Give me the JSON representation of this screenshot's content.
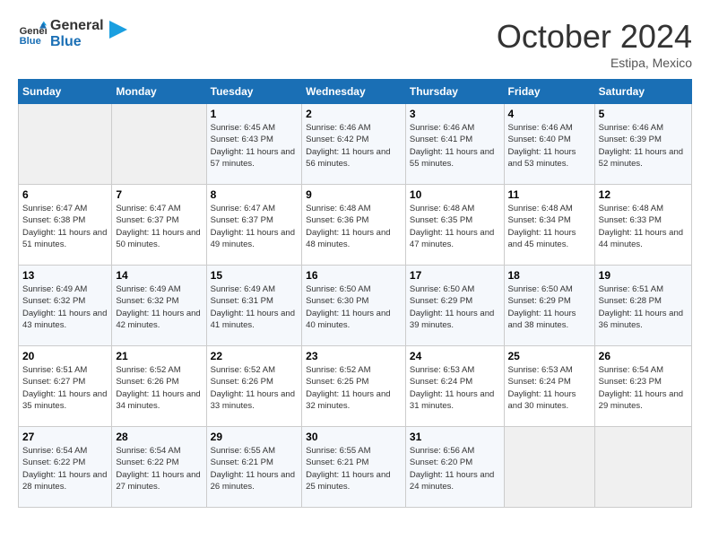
{
  "logo": {
    "line1": "General",
    "line2": "Blue"
  },
  "title": "October 2024",
  "location": "Estipa, Mexico",
  "days_header": [
    "Sunday",
    "Monday",
    "Tuesday",
    "Wednesday",
    "Thursday",
    "Friday",
    "Saturday"
  ],
  "weeks": [
    [
      {
        "day": "",
        "sunrise": "",
        "sunset": "",
        "daylight": ""
      },
      {
        "day": "",
        "sunrise": "",
        "sunset": "",
        "daylight": ""
      },
      {
        "day": "1",
        "sunrise": "Sunrise: 6:45 AM",
        "sunset": "Sunset: 6:43 PM",
        "daylight": "Daylight: 11 hours and 57 minutes."
      },
      {
        "day": "2",
        "sunrise": "Sunrise: 6:46 AM",
        "sunset": "Sunset: 6:42 PM",
        "daylight": "Daylight: 11 hours and 56 minutes."
      },
      {
        "day": "3",
        "sunrise": "Sunrise: 6:46 AM",
        "sunset": "Sunset: 6:41 PM",
        "daylight": "Daylight: 11 hours and 55 minutes."
      },
      {
        "day": "4",
        "sunrise": "Sunrise: 6:46 AM",
        "sunset": "Sunset: 6:40 PM",
        "daylight": "Daylight: 11 hours and 53 minutes."
      },
      {
        "day": "5",
        "sunrise": "Sunrise: 6:46 AM",
        "sunset": "Sunset: 6:39 PM",
        "daylight": "Daylight: 11 hours and 52 minutes."
      }
    ],
    [
      {
        "day": "6",
        "sunrise": "Sunrise: 6:47 AM",
        "sunset": "Sunset: 6:38 PM",
        "daylight": "Daylight: 11 hours and 51 minutes."
      },
      {
        "day": "7",
        "sunrise": "Sunrise: 6:47 AM",
        "sunset": "Sunset: 6:37 PM",
        "daylight": "Daylight: 11 hours and 50 minutes."
      },
      {
        "day": "8",
        "sunrise": "Sunrise: 6:47 AM",
        "sunset": "Sunset: 6:37 PM",
        "daylight": "Daylight: 11 hours and 49 minutes."
      },
      {
        "day": "9",
        "sunrise": "Sunrise: 6:48 AM",
        "sunset": "Sunset: 6:36 PM",
        "daylight": "Daylight: 11 hours and 48 minutes."
      },
      {
        "day": "10",
        "sunrise": "Sunrise: 6:48 AM",
        "sunset": "Sunset: 6:35 PM",
        "daylight": "Daylight: 11 hours and 47 minutes."
      },
      {
        "day": "11",
        "sunrise": "Sunrise: 6:48 AM",
        "sunset": "Sunset: 6:34 PM",
        "daylight": "Daylight: 11 hours and 45 minutes."
      },
      {
        "day": "12",
        "sunrise": "Sunrise: 6:48 AM",
        "sunset": "Sunset: 6:33 PM",
        "daylight": "Daylight: 11 hours and 44 minutes."
      }
    ],
    [
      {
        "day": "13",
        "sunrise": "Sunrise: 6:49 AM",
        "sunset": "Sunset: 6:32 PM",
        "daylight": "Daylight: 11 hours and 43 minutes."
      },
      {
        "day": "14",
        "sunrise": "Sunrise: 6:49 AM",
        "sunset": "Sunset: 6:32 PM",
        "daylight": "Daylight: 11 hours and 42 minutes."
      },
      {
        "day": "15",
        "sunrise": "Sunrise: 6:49 AM",
        "sunset": "Sunset: 6:31 PM",
        "daylight": "Daylight: 11 hours and 41 minutes."
      },
      {
        "day": "16",
        "sunrise": "Sunrise: 6:50 AM",
        "sunset": "Sunset: 6:30 PM",
        "daylight": "Daylight: 11 hours and 40 minutes."
      },
      {
        "day": "17",
        "sunrise": "Sunrise: 6:50 AM",
        "sunset": "Sunset: 6:29 PM",
        "daylight": "Daylight: 11 hours and 39 minutes."
      },
      {
        "day": "18",
        "sunrise": "Sunrise: 6:50 AM",
        "sunset": "Sunset: 6:29 PM",
        "daylight": "Daylight: 11 hours and 38 minutes."
      },
      {
        "day": "19",
        "sunrise": "Sunrise: 6:51 AM",
        "sunset": "Sunset: 6:28 PM",
        "daylight": "Daylight: 11 hours and 36 minutes."
      }
    ],
    [
      {
        "day": "20",
        "sunrise": "Sunrise: 6:51 AM",
        "sunset": "Sunset: 6:27 PM",
        "daylight": "Daylight: 11 hours and 35 minutes."
      },
      {
        "day": "21",
        "sunrise": "Sunrise: 6:52 AM",
        "sunset": "Sunset: 6:26 PM",
        "daylight": "Daylight: 11 hours and 34 minutes."
      },
      {
        "day": "22",
        "sunrise": "Sunrise: 6:52 AM",
        "sunset": "Sunset: 6:26 PM",
        "daylight": "Daylight: 11 hours and 33 minutes."
      },
      {
        "day": "23",
        "sunrise": "Sunrise: 6:52 AM",
        "sunset": "Sunset: 6:25 PM",
        "daylight": "Daylight: 11 hours and 32 minutes."
      },
      {
        "day": "24",
        "sunrise": "Sunrise: 6:53 AM",
        "sunset": "Sunset: 6:24 PM",
        "daylight": "Daylight: 11 hours and 31 minutes."
      },
      {
        "day": "25",
        "sunrise": "Sunrise: 6:53 AM",
        "sunset": "Sunset: 6:24 PM",
        "daylight": "Daylight: 11 hours and 30 minutes."
      },
      {
        "day": "26",
        "sunrise": "Sunrise: 6:54 AM",
        "sunset": "Sunset: 6:23 PM",
        "daylight": "Daylight: 11 hours and 29 minutes."
      }
    ],
    [
      {
        "day": "27",
        "sunrise": "Sunrise: 6:54 AM",
        "sunset": "Sunset: 6:22 PM",
        "daylight": "Daylight: 11 hours and 28 minutes."
      },
      {
        "day": "28",
        "sunrise": "Sunrise: 6:54 AM",
        "sunset": "Sunset: 6:22 PM",
        "daylight": "Daylight: 11 hours and 27 minutes."
      },
      {
        "day": "29",
        "sunrise": "Sunrise: 6:55 AM",
        "sunset": "Sunset: 6:21 PM",
        "daylight": "Daylight: 11 hours and 26 minutes."
      },
      {
        "day": "30",
        "sunrise": "Sunrise: 6:55 AM",
        "sunset": "Sunset: 6:21 PM",
        "daylight": "Daylight: 11 hours and 25 minutes."
      },
      {
        "day": "31",
        "sunrise": "Sunrise: 6:56 AM",
        "sunset": "Sunset: 6:20 PM",
        "daylight": "Daylight: 11 hours and 24 minutes."
      },
      {
        "day": "",
        "sunrise": "",
        "sunset": "",
        "daylight": ""
      },
      {
        "day": "",
        "sunrise": "",
        "sunset": "",
        "daylight": ""
      }
    ]
  ]
}
